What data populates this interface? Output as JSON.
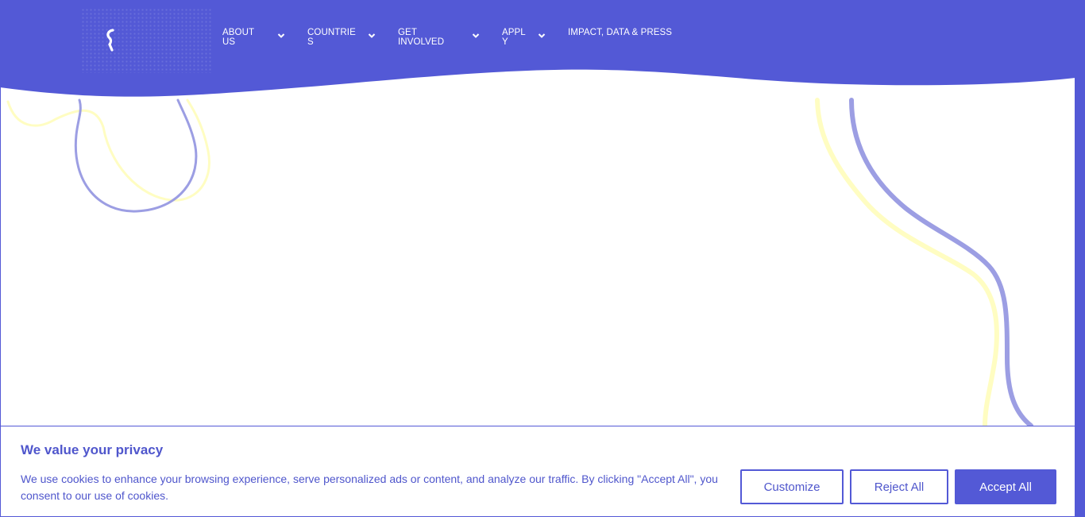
{
  "colors": {
    "brand": "#5359d6",
    "accent_yellow": "#fffdc2",
    "accent_lavender": "#9c9ee3",
    "text_on_brand": "#ffffff"
  },
  "header": {
    "logo_icon": "s-mark-logo",
    "nav": [
      {
        "label": "ABOUT\nUS",
        "has_dropdown": true,
        "icon": "chevron-down-icon"
      },
      {
        "label": "COUNTRIE\nS",
        "has_dropdown": true,
        "icon": "chevron-down-icon"
      },
      {
        "label": "GET\nINVOLVED",
        "has_dropdown": true,
        "icon": "chevron-down-icon"
      },
      {
        "label": "APPL\nY",
        "has_dropdown": true,
        "icon": "chevron-down-icon"
      },
      {
        "label": "IMPACT, DATA & PRESS",
        "has_dropdown": false
      }
    ]
  },
  "consent": {
    "title": "We value your privacy",
    "body": "We use cookies to enhance your browsing experience, serve personalized ads or content, and analyze our traffic. By clicking \"Accept All\", you consent to our use of cookies.",
    "buttons": {
      "customize": "Customize",
      "reject": "Reject All",
      "accept": "Accept All"
    }
  }
}
